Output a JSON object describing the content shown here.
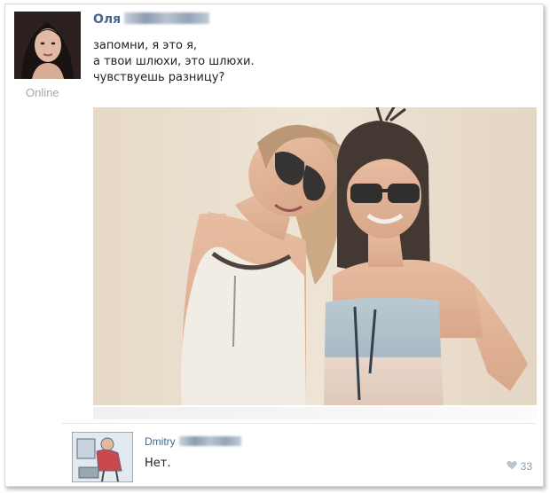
{
  "post": {
    "author_name": "Оля",
    "online_status": "Online",
    "text_lines": [
      "запомни, я это я,",
      "а твои шлюхи, это шлюхи.",
      "чувствуешь разницу?"
    ]
  },
  "comment": {
    "author_name": "Dmitry",
    "text": "Нет.",
    "likes": "33"
  },
  "colors": {
    "link": "#45688e",
    "text": "#222222",
    "muted": "#a8a8a8",
    "like": "#8f9bab"
  },
  "icons": {
    "like": "heart-icon"
  }
}
